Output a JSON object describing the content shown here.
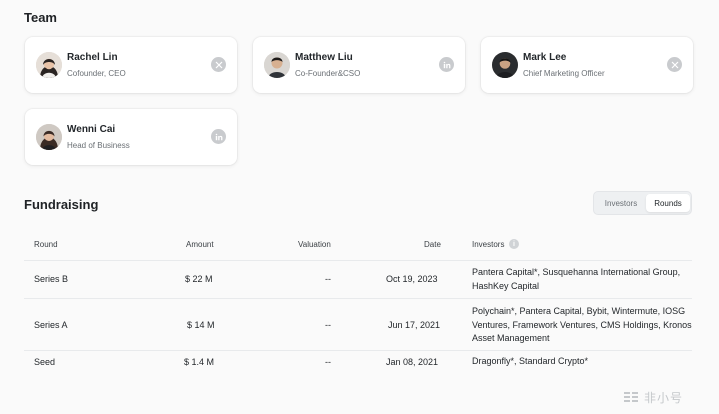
{
  "team": {
    "title": "Team",
    "members": [
      {
        "name": "Rachel Lin",
        "role": "Cofounder, CEO",
        "social": "x-icon"
      },
      {
        "name": "Matthew Liu",
        "role": "Co-Founder&CSO",
        "social": "linkedin-icon"
      },
      {
        "name": "Mark Lee",
        "role": "Chief Marketing Officer",
        "social": "x-icon"
      },
      {
        "name": "Wenni Cai",
        "role": "Head of Business",
        "social": "linkedin-icon"
      }
    ]
  },
  "fundraising": {
    "title": "Fundraising",
    "toggle": {
      "options": [
        "Investors",
        "Rounds"
      ],
      "selected": "Rounds"
    },
    "columns": [
      "Round",
      "Amount",
      "Valuation",
      "Date",
      "Investors"
    ],
    "rows": [
      {
        "round": "Series B",
        "amount": "$ 22 M",
        "valuation": "--",
        "date": "Oct 19, 2023",
        "investors": "Pantera Capital*, Susquehanna International Group, HashKey Capital"
      },
      {
        "round": "Series A",
        "amount": "$ 14 M",
        "valuation": "--",
        "date": "Jun 17, 2021",
        "investors": "Polychain*, Pantera Capital, Bybit, Wintermute, IOSG Ventures, Framework Ventures, CMS Holdings, Kronos Asset Management"
      },
      {
        "round": "Seed",
        "amount": "$ 1.4 M",
        "valuation": "--",
        "date": "Jan 08, 2021",
        "investors": "Dragonfly*, Standard Crypto*"
      }
    ]
  },
  "watermark": {
    "text": "非小号"
  },
  "colors": {
    "accent": "#23272b",
    "muted": "#6b7075",
    "icon": "#c9cbce"
  }
}
